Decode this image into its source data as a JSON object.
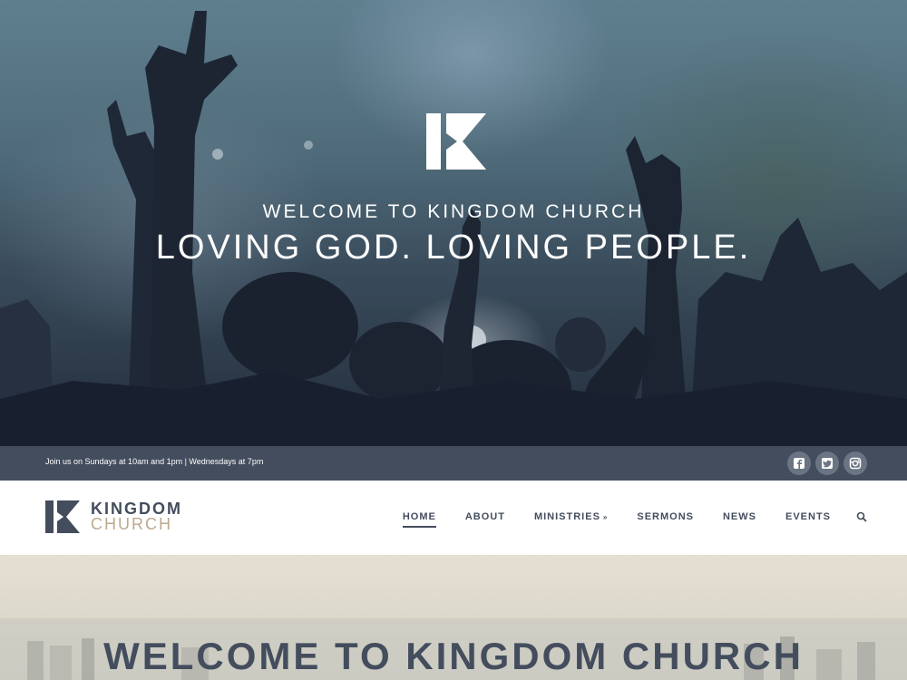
{
  "hero": {
    "kicker": "WELCOME TO KINGDOM CHURCH",
    "headline": "LOVING GOD. LOVING PEOPLE."
  },
  "topbar": {
    "service_times": "Join us on Sundays at 10am and 1pm | Wednesdays at 7pm",
    "social": [
      "facebook-icon",
      "twitter-icon",
      "instagram-icon"
    ]
  },
  "brand": {
    "line1": "KINGDOM",
    "line2": "CHURCH"
  },
  "nav": {
    "items": [
      {
        "label": "HOME",
        "active": true
      },
      {
        "label": "ABOUT"
      },
      {
        "label": "MINISTRIES",
        "dropdown": true
      },
      {
        "label": "SERMONS"
      },
      {
        "label": "NEWS"
      },
      {
        "label": "EVENTS"
      }
    ],
    "search_icon": "search-icon",
    "dropdown_glyph": "»"
  },
  "welcome": {
    "title": "WELCOME TO KINGDOM CHURCH"
  },
  "colors": {
    "primary": "#434d5d",
    "accent": "#bca98e",
    "topbar_bg": "#434d5d",
    "social_btn": "#6b7482"
  }
}
